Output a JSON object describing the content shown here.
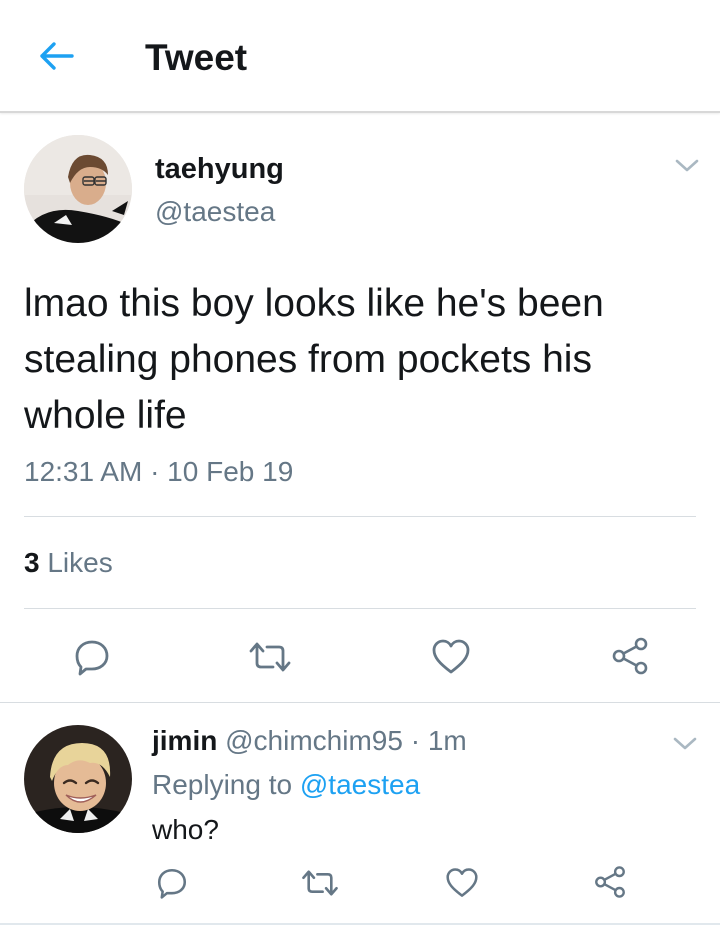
{
  "header": {
    "title": "Tweet",
    "back_icon": "back-arrow-icon",
    "accent_color": "#1da1f2"
  },
  "tweet": {
    "display_name": "taehyung",
    "handle": "@taestea",
    "text": "lmao this boy looks like he's been stealing phones from pockets his whole life",
    "timestamp": "12:31 AM · 10 Feb 19",
    "likes_count": "3",
    "likes_label": "Likes",
    "actions": [
      "reply-icon",
      "retweet-icon",
      "like-icon",
      "share-icon"
    ]
  },
  "reply": {
    "display_name": "jimin",
    "handle": "@chimchim95",
    "separator": " · ",
    "time": "1m",
    "replying_prefix": "Replying to ",
    "replying_to": "@taestea",
    "text": "who?",
    "actions": [
      "reply-icon",
      "retweet-icon",
      "like-icon",
      "share-icon"
    ]
  },
  "colors": {
    "text_primary": "#14171a",
    "text_secondary": "#657786",
    "link": "#1da1f2",
    "divider": "#d8dde1"
  }
}
